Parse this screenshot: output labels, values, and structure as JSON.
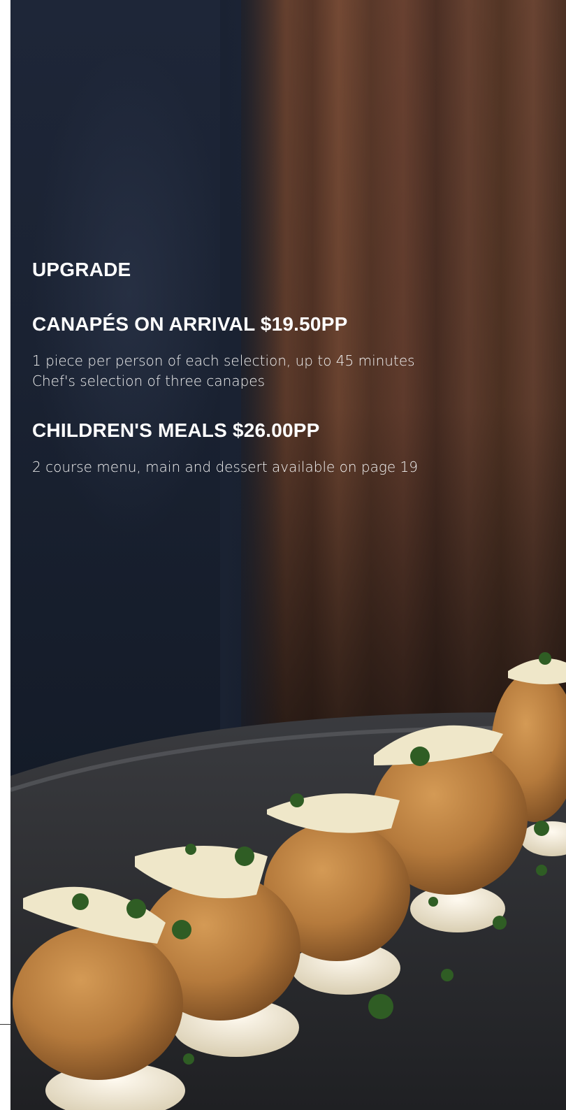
{
  "sections": {
    "upgrade_title": "UPGRADE",
    "canapes": {
      "title": "CANAPÉS ON ARRIVAL $19.50PP",
      "line1": "1 piece per person of each selection, up to 45 minutes",
      "line2": "Chef's selection of three canapes"
    },
    "children": {
      "title": "CHILDREN'S MEALS $26.00PP",
      "line1": "2 course menu, main and dessert available on page 19"
    }
  },
  "colors": {
    "text": "#ffffff",
    "plate": "#2c2d30",
    "croquette": "#b77c3e",
    "cream": "#f1ead6",
    "herb": "#2f5d24"
  }
}
